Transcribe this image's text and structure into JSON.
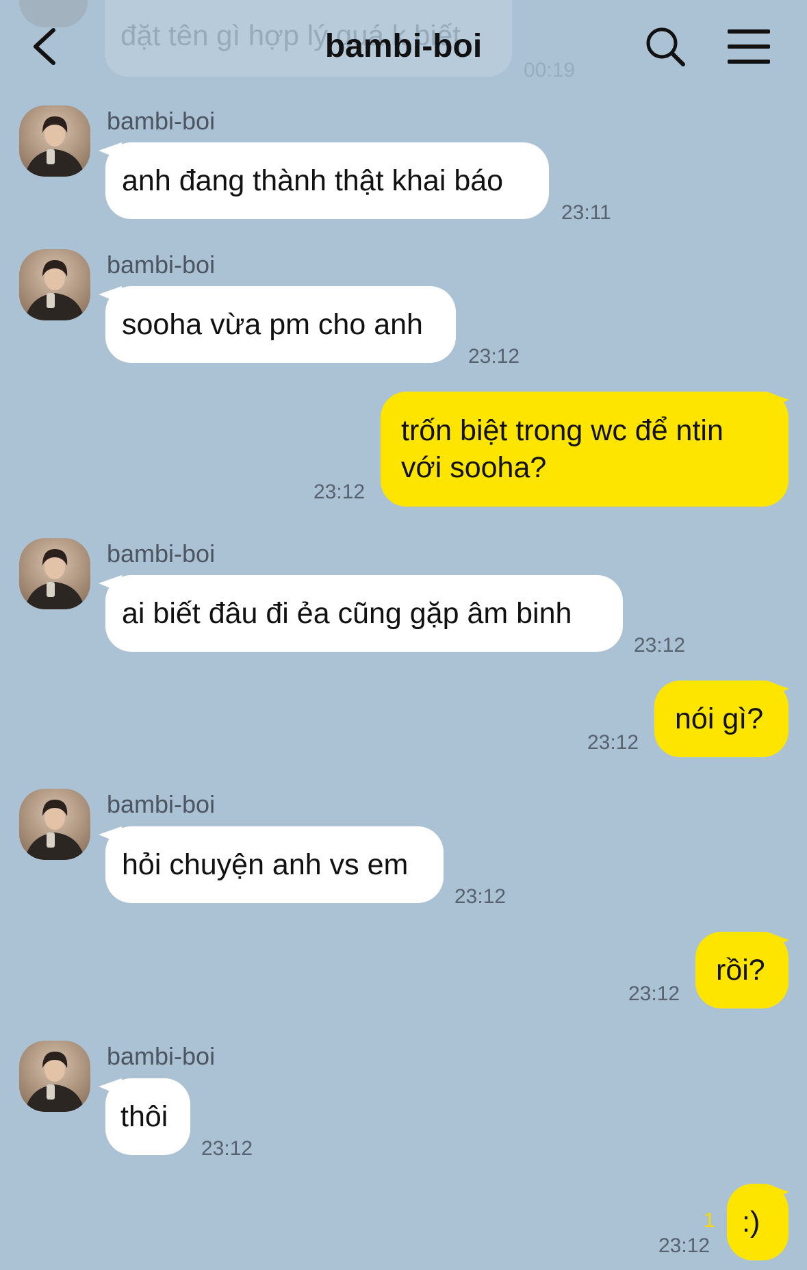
{
  "header": {
    "title": "bambi-boi",
    "faded_preview": {
      "text": "đặt tên gì hợp lý quá k biết",
      "time": "00:19"
    }
  },
  "messages": [
    {
      "sender": "bambi-boi",
      "text": "anh đang thành thật khai báo",
      "time": "23:11"
    },
    {
      "sender": "bambi-boi",
      "text": "sooha vừa pm cho anh",
      "time": "23:12"
    },
    {
      "line1": "trốn biệt trong wc để ntin",
      "line2": "với sooha?",
      "time": "23:12"
    },
    {
      "sender": "bambi-boi",
      "text": "ai biết đâu đi ẻa cũng gặp âm binh",
      "time": "23:12"
    },
    {
      "text": "nói gì?",
      "time": "23:12"
    },
    {
      "sender": "bambi-boi",
      "text": "hỏi chuyện anh vs em",
      "time": "23:12"
    },
    {
      "text": "rồi?",
      "time": "23:12"
    },
    {
      "sender": "bambi-boi",
      "text": "thôi",
      "time": "23:12"
    },
    {
      "text": ":)",
      "time": "23:12",
      "unread": "1"
    }
  ],
  "colors": {
    "background": "#abc1d4",
    "incoming": "#ffffff",
    "outgoing": "#fee500"
  },
  "icons": [
    "back-chevron-icon",
    "search-icon",
    "menu-icon"
  ]
}
